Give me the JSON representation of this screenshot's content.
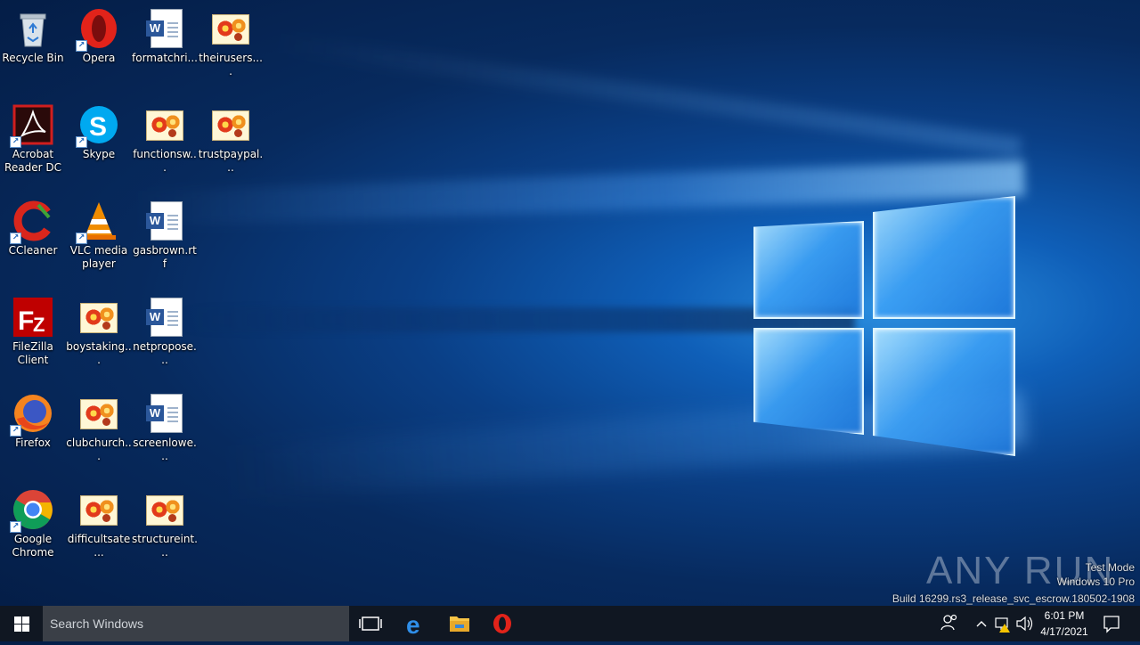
{
  "desktop": {
    "icons": [
      {
        "label": "Recycle Bin",
        "icon": "recycle-bin-icon"
      },
      {
        "label": "Opera",
        "icon": "opera-icon"
      },
      {
        "label": "formatchri...",
        "icon": "word-document-icon"
      },
      {
        "label": "theirusers....",
        "icon": "image-file-icon"
      },
      {
        "label": "Acrobat Reader DC",
        "icon": "acrobat-reader-icon"
      },
      {
        "label": "Skype",
        "icon": "skype-icon"
      },
      {
        "label": "functionsw...",
        "icon": "image-file-icon"
      },
      {
        "label": "trustpaypal...",
        "icon": "image-file-icon"
      },
      {
        "label": "CCleaner",
        "icon": "ccleaner-icon"
      },
      {
        "label": "VLC media player",
        "icon": "vlc-icon"
      },
      {
        "label": "gasbrown.rtf",
        "icon": "word-document-icon"
      },
      {
        "label": "FileZilla Client",
        "icon": "filezilla-icon"
      },
      {
        "label": "boystaking...",
        "icon": "image-file-icon"
      },
      {
        "label": "netpropose...",
        "icon": "word-document-icon"
      },
      {
        "label": "Firefox",
        "icon": "firefox-icon"
      },
      {
        "label": "clubchurch...",
        "icon": "image-file-icon"
      },
      {
        "label": "screenlowe...",
        "icon": "word-document-icon"
      },
      {
        "label": "Google Chrome",
        "icon": "chrome-icon"
      },
      {
        "label": "difficultsate...",
        "icon": "image-file-icon"
      },
      {
        "label": "structureint...",
        "icon": "image-file-icon"
      }
    ]
  },
  "watermark": {
    "brand": "ANY RUN",
    "line1": "Test Mode",
    "line2": "Windows 10 Pro",
    "line3": "Build 16299.rs3_release_svc_escrow.180502-1908"
  },
  "taskbar": {
    "search_placeholder": "Search Windows",
    "clock_time": "6:01 PM",
    "clock_date": "4/17/2021",
    "pinned": [
      "task-view-icon",
      "edge-icon",
      "file-explorer-icon",
      "opera-icon"
    ]
  },
  "colors": {
    "taskbar_bg": "#101722",
    "search_bg": "#3a3f47",
    "accent": "#1e90ff"
  }
}
